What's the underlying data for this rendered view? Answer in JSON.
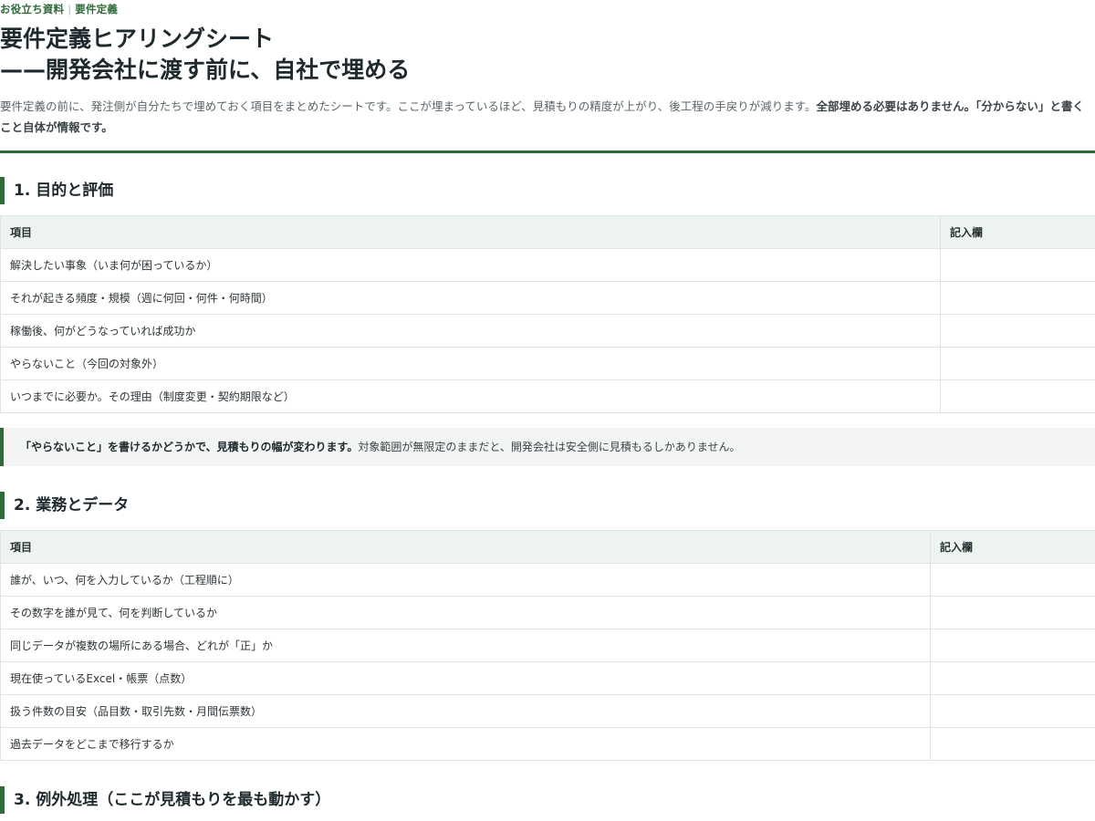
{
  "breadcrumb": {
    "parent": "お役立ち資料",
    "separator": "|",
    "current": "要件定義"
  },
  "title": {
    "line1": "要件定義ヒアリングシート",
    "line2": "——開発会社に渡す前に、自社で埋める"
  },
  "lead": {
    "normal": "要件定義の前に、発注側が自分たちで埋めておく項目をまとめたシートです。ここが埋まっているほど、見積もりの精度が上がり、後工程の手戻りが減ります。",
    "bold": "全部埋める必要はありません。「分からない」と書くこと自体が情報です。"
  },
  "sections": [
    {
      "heading": "1. 目的と評価",
      "col_item": "項目",
      "col_entry": "記入欄",
      "rows": [
        "解決したい事象（いま何が困っているか）",
        "それが起きる頻度・規模（週に何回・何件・何時間）",
        "稼働後、何がどうなっていれば成功か",
        "やらないこと（今回の対象外）",
        "いつまでに必要か。その理由（制度変更・契約期限など）"
      ],
      "note": {
        "bold": "「やらないこと」を書けるかどうかで、見積もりの幅が変わります。",
        "normal": "対象範囲が無限定のままだと、開発会社は安全側に見積もるしかありません。"
      }
    },
    {
      "heading": "2. 業務とデータ",
      "col_item": "項目",
      "col_entry": "記入欄",
      "rows": [
        "誰が、いつ、何を入力しているか（工程順に）",
        "その数字を誰が見て、何を判断しているか",
        "同じデータが複数の場所にある場合、どれが「正」か",
        "現在使っているExcel・帳票（点数）",
        "扱う件数の目安（品目数・取引先数・月間伝票数）",
        "過去データをどこまで移行するか"
      ]
    },
    {
      "heading": "3. 例外処理（ここが見積もりを最も動かす）"
    }
  ]
}
